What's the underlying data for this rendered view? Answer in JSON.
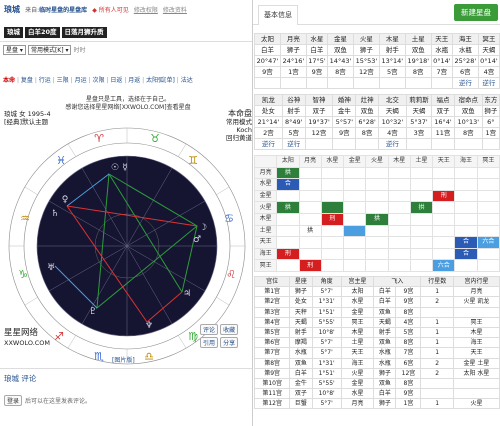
{
  "header": {
    "name": "琅城",
    "source_prefix": "来自:",
    "source": "临时星盘的星盘库",
    "public": "◆ 所有人可见",
    "edit_link": "修改权限",
    "share_link": "修改资料",
    "tags": [
      "琅城",
      "白羊20度",
      "日落月狮升质"
    ]
  },
  "controls": {
    "chart_select": "星盘",
    "mode_select": "常用模式[K]",
    "hint": "时时"
  },
  "modes": [
    "本命",
    "复盘",
    "行运",
    "三限",
    "月运",
    "次限",
    "日返",
    "月返",
    "太阳弧",
    "[单]",
    "法达"
  ],
  "chart": {
    "message_line1": "星盘只是工具，选择在于自己。",
    "message_line2": "感谢您选择星星网络[XXWOLO.COM]查看星盘",
    "who_line1": "琅城 女 1995-4",
    "who_line2": "[经典]默认主题",
    "info_title": "本命盘",
    "info_line1": "常用模式",
    "info_line2": "Koch",
    "info_line3": "回归黄道",
    "site_name": "星星网络",
    "site_url": "XXWOLO.COM",
    "buttons": [
      "评论",
      "收藏",
      "引用",
      "分享"
    ],
    "zoom": "[图片版]"
  },
  "comments": {
    "title": "琅城 评论",
    "login_btn": "登录",
    "login_text": "后可以在这里发表评论。"
  },
  "right": {
    "tab": "基本信息",
    "new_button": "新建星盘",
    "planets1": {
      "names": [
        "太阳",
        "月亮",
        "水星",
        "金星",
        "火星",
        "木星",
        "土星",
        "天王",
        "海王",
        "冥王"
      ],
      "signs": [
        "白羊",
        "狮子",
        "白羊",
        "双鱼",
        "狮子",
        "射手",
        "双鱼",
        "水瓶",
        "水瓶",
        "天蝎"
      ],
      "degrees": [
        "20°47'",
        "24°16'",
        "17°5'",
        "14°43'",
        "15°53'",
        "13°14'",
        "19°18'",
        "0°14'",
        "25°28'",
        "0°14'"
      ],
      "houses": [
        "9宫",
        "1宫",
        "9宫",
        "8宫",
        "12宫",
        "5宫",
        "8宫",
        "7宫",
        "6宫",
        "4宫"
      ],
      "retro": [
        "",
        "",
        "",
        "",
        "",
        "",
        "",
        "",
        "逆行",
        "逆行"
      ]
    },
    "planets2": {
      "names": [
        "凯龙",
        "谷神",
        "智神",
        "婚神",
        "灶神",
        "北交",
        "莉莉斯",
        "福点",
        "宿命点",
        "东方"
      ],
      "signs": [
        "处女",
        "射手",
        "双子",
        "金牛",
        "双鱼",
        "天蝎",
        "天蝎",
        "双子",
        "双鱼",
        "狮子"
      ],
      "degrees": [
        "21°14'",
        "8°49'",
        "19°37'",
        "5°57'",
        "6°28'",
        "10°32'",
        "5°37'",
        "16°4'",
        "10°13'",
        "6°"
      ],
      "houses": [
        "2宫",
        "5宫",
        "12宫",
        "9宫",
        "8宫",
        "4宫",
        "3宫",
        "11宫",
        "8宫",
        "1宫"
      ],
      "retro": [
        "逆行",
        "逆行",
        "",
        "",
        "",
        "逆行",
        "",
        "",
        "",
        ""
      ]
    },
    "aspects": {
      "header": [
        "太阳",
        "月亮",
        "水星",
        "金星",
        "火星",
        "木星",
        "土星",
        "天王",
        "海王",
        "冥王"
      ],
      "rows": [
        {
          "name": "月亮",
          "cells": [
            "拱",
            "",
            "",
            "",
            "",
            "",
            "",
            "",
            "",
            ""
          ],
          "colors": [
            "g",
            "",
            "",
            "",
            "",
            "",
            "",
            "",
            "",
            ""
          ]
        },
        {
          "name": "水星",
          "cells": [
            "合",
            "",
            "",
            "",
            "",
            "",
            "",
            "",
            "",
            ""
          ],
          "colors": [
            "b",
            "",
            "",
            "",
            "",
            "",
            "",
            "",
            "",
            ""
          ]
        },
        {
          "name": "金星",
          "cells": [
            "",
            "",
            "",
            "",
            "",
            "",
            "",
            "刑",
            "",
            ""
          ],
          "colors": [
            "",
            "",
            "",
            "",
            "",
            "",
            "",
            "r",
            "",
            ""
          ]
        },
        {
          "name": "火星",
          "cells": [
            "拱",
            "",
            "",
            "",
            "",
            "",
            "拱",
            "",
            "",
            ""
          ],
          "colors": [
            "g",
            "",
            "g",
            "",
            "",
            "",
            "g",
            "",
            "",
            ""
          ]
        },
        {
          "name": "木星",
          "cells": [
            "",
            "",
            "刑",
            "",
            "拱",
            "",
            "",
            "",
            "",
            ""
          ],
          "colors": [
            "",
            "",
            "r",
            "",
            "g",
            "",
            "",
            "",
            "",
            ""
          ]
        },
        {
          "name": "土星",
          "cells": [
            "",
            "拱",
            "",
            "",
            "",
            "",
            "",
            "",
            "",
            ""
          ],
          "colors": [
            "",
            "",
            "",
            "c",
            "",
            "",
            "",
            "",
            "",
            ""
          ]
        },
        {
          "name": "天王",
          "cells": [
            "",
            "",
            "",
            "",
            "",
            "",
            "",
            "",
            "合",
            "六合"
          ],
          "colors": [
            "",
            "",
            "",
            "",
            "",
            "",
            "",
            "",
            "b",
            "c"
          ]
        },
        {
          "name": "海王",
          "cells": [
            "刑",
            "",
            "",
            "",
            "",
            "",
            "",
            "",
            "合",
            ""
          ],
          "colors": [
            "r",
            "",
            "",
            "",
            "",
            "",
            "",
            "",
            "b",
            ""
          ]
        },
        {
          "name": "冥王",
          "cells": [
            "",
            "刑",
            "",
            "",
            "",
            "",
            "",
            "六合",
            "",
            ""
          ],
          "colors": [
            "",
            "r",
            "",
            "",
            "",
            "",
            "",
            "c",
            "",
            ""
          ]
        }
      ]
    },
    "houses": {
      "header": [
        "宫位",
        "星座",
        "角度",
        "宫主星",
        "飞入",
        "行星数",
        "宫内行星"
      ],
      "rows": [
        [
          "第1宫",
          "狮子",
          "5°7'",
          "太阳",
          "白羊",
          "9宫",
          "1",
          "月亮"
        ],
        [
          "第2宫",
          "处女",
          "1°31'",
          "水星",
          "白羊",
          "9宫",
          "2",
          "火星 凯龙"
        ],
        [
          "第3宫",
          "天秤",
          "1°51'",
          "金星",
          "双鱼",
          "8宫",
          "",
          ""
        ],
        [
          "第4宫",
          "天蝎",
          "5°55'",
          "冥王",
          "天蝎",
          "4宫",
          "1",
          "冥王"
        ],
        [
          "第5宫",
          "射手",
          "10°8'",
          "木星",
          "射手",
          "5宫",
          "1",
          "木星"
        ],
        [
          "第6宫",
          "摩羯",
          "5°7'",
          "土星",
          "双鱼",
          "8宫",
          "1",
          "海王"
        ],
        [
          "第7宫",
          "水瓶",
          "5°7'",
          "天王",
          "水瓶",
          "7宫",
          "1",
          "天王"
        ],
        [
          "第8宫",
          "双鱼",
          "1°31'",
          "海王",
          "水瓶",
          "6宫",
          "2",
          "金星 土星"
        ],
        [
          "第9宫",
          "白羊",
          "1°51'",
          "火星",
          "狮子",
          "12宫",
          "2",
          "太阳 水星"
        ],
        [
          "第10宫",
          "金牛",
          "5°55'",
          "金星",
          "双鱼",
          "8宫",
          "",
          ""
        ],
        [
          "第11宫",
          "双子",
          "10°8'",
          "水星",
          "白羊",
          "9宫",
          "",
          ""
        ],
        [
          "第12宫",
          "巨蟹",
          "5°7'",
          "月亮",
          "狮子",
          "1宫",
          "1",
          "火星"
        ]
      ]
    }
  }
}
